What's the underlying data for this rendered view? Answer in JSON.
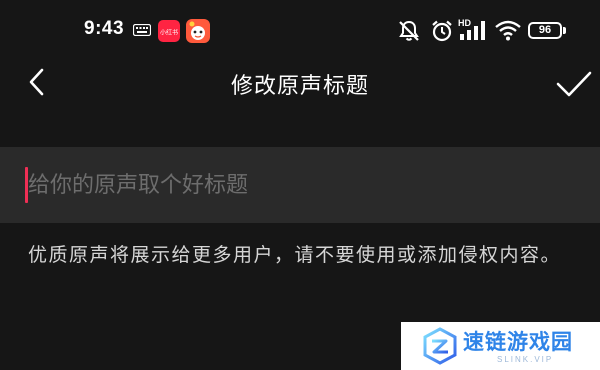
{
  "status_bar": {
    "time": "9:43",
    "app_badge": "小红书",
    "battery": "96",
    "network_label": "HD",
    "icons": [
      "keyboard-icon",
      "app-icon",
      "cartoon-app-icon",
      "mute-icon",
      "alarm-icon",
      "hd-signal-icon",
      "wifi-icon",
      "battery-icon"
    ]
  },
  "header": {
    "title": "修改原声标题",
    "back_icon": "chevron-left-icon",
    "confirm_icon": "checkmark-icon"
  },
  "input": {
    "value": "",
    "placeholder": "给你的原声取个好标题"
  },
  "hint": "优质原声将展示给更多用户，请不要使用或添加侵权内容。",
  "watermark": {
    "brand": "速链游戏园",
    "sub": "SLINK.VIP"
  },
  "colors": {
    "background": "#161616",
    "input_background": "#2a2a2a",
    "caret": "#ef2f55",
    "placeholder": "#6d6d6d",
    "watermark_accent": "#2f84e8"
  }
}
